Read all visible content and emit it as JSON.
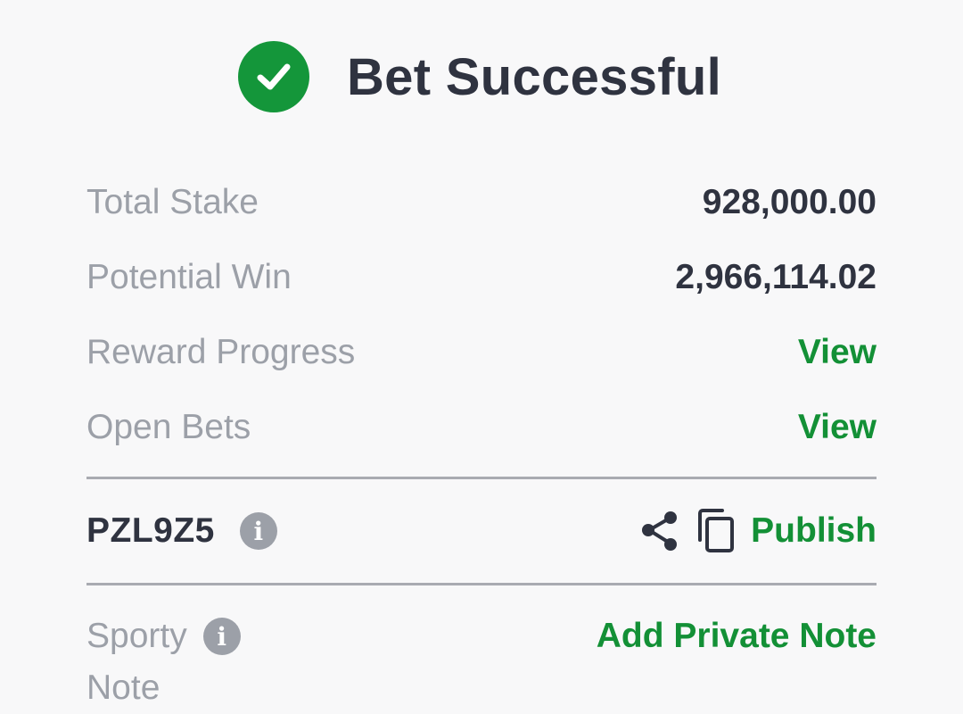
{
  "header": {
    "title": "Bet Successful",
    "icon": "check-circle-icon",
    "accent_color": "#14963a"
  },
  "summary": {
    "total_stake_label": "Total Stake",
    "total_stake_value": "928,000.00",
    "potential_win_label": "Potential Win",
    "potential_win_value": "2,966,114.02",
    "reward_progress_label": "Reward Progress",
    "reward_progress_link": "View",
    "open_bets_label": "Open Bets",
    "open_bets_link": "View"
  },
  "booking": {
    "code": "PZL9Z5",
    "info_icon": "info-icon",
    "share_icon": "share-icon",
    "copy_icon": "copy-icon",
    "publish_label": "Publish"
  },
  "note": {
    "label_line1": "Sporty",
    "label_line2": "Note",
    "info_icon": "info-icon",
    "add_note_label": "Add Private Note"
  }
}
